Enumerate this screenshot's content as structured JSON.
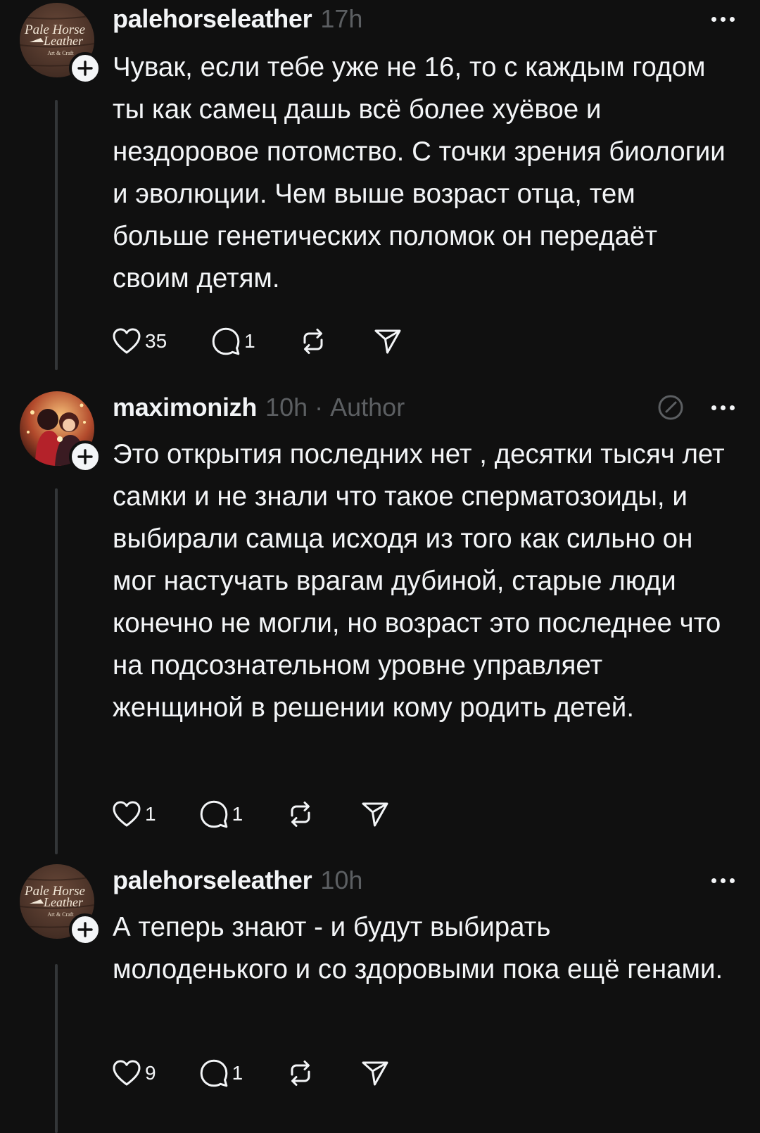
{
  "colors": {
    "background": "#101010",
    "text": "#f3f5f7",
    "secondary": "#5c5f62",
    "thread_line": "#333638"
  },
  "posts": [
    {
      "username": "palehorseleather",
      "time": "17h",
      "author_tag": "",
      "avatar": "pale-horse-leather-logo",
      "avatar_text": [
        "Pale Horse",
        "Leather",
        "Art & Craft"
      ],
      "text": "Чувак, если тебе уже не 16, то с каждым годом ты как самец дашь всё более хуёвое и нездоровое потомство. С точки зрения биологии и эволюции. Чем выше возраст отца, тем больше генетических поломок он передаёт своим детям.",
      "likes": "35",
      "replies": "1",
      "show_edit": false
    },
    {
      "username": "maximonizh",
      "time": "10h",
      "author_tag": "Author",
      "avatar": "couple-illustration-avatar",
      "avatar_text": [],
      "text": "Это открытия последних нет , десятки тысяч лет самки и не знали что такое сперматозоиды, и выбирали самца исходя из того как сильно он мог настучать врагам дубиной, старые люди конечно не могли, но возраст это последнее что на подсознательном уровне управляет женщиной в решении кому родить детей.",
      "likes": "1",
      "replies": "1",
      "show_edit": true
    },
    {
      "username": "palehorseleather",
      "time": "10h",
      "author_tag": "",
      "avatar": "pale-horse-leather-logo",
      "avatar_text": [
        "Pale Horse",
        "Leather",
        "Art & Craft"
      ],
      "text": "А теперь знают - и будут выбирать молоденького и со здоровыми пока ещё генами.",
      "likes": "9",
      "replies": "1",
      "show_edit": false
    }
  ]
}
